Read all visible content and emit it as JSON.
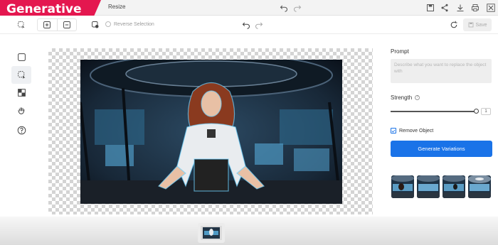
{
  "badge": {
    "text": "Generative fill"
  },
  "titlebar": {
    "resize_label": "Resize"
  },
  "toolbar": {
    "reverse_selection_label": "Reverse Selection",
    "save_label": "Save"
  },
  "panel": {
    "prompt_label": "Prompt",
    "prompt_placeholder": "Describe what you want to replace the object with",
    "strength_label": "Strength",
    "strength_help": "?",
    "strength_value": "1",
    "strength_fraction": 1.0,
    "remove_object_label": "Remove Object",
    "remove_object_checked": true,
    "generate_label": "Generate Variations"
  },
  "variations_count": 4,
  "colors": {
    "accent": "#1a73e8",
    "badge": "#e4174f"
  }
}
